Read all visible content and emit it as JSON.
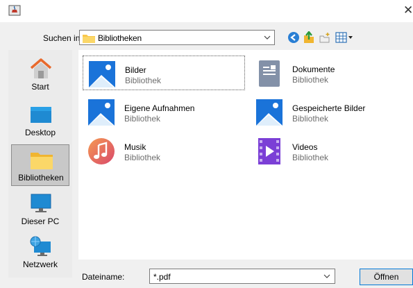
{
  "titlebar": {
    "app_icon": "java-cup-icon",
    "close_glyph": "✕"
  },
  "lookin": {
    "label": "Suchen in:",
    "value": "Bibliotheken"
  },
  "toolbar": [
    "back-arrow-icon",
    "up-folder-icon",
    "new-folder-icon",
    "view-menu-icon"
  ],
  "sidebar": {
    "items": [
      {
        "label": "Start",
        "icon": "home-icon",
        "selected": false
      },
      {
        "label": "Desktop",
        "icon": "desktop-icon",
        "selected": false
      },
      {
        "label": "Bibliotheken",
        "icon": "libraries-folder-icon",
        "selected": true
      },
      {
        "label": "Dieser PC",
        "icon": "computer-icon",
        "selected": false
      },
      {
        "label": "Netzwerk",
        "icon": "network-icon",
        "selected": false
      }
    ]
  },
  "files": [
    {
      "name": "Bilder",
      "type": "Bibliothek",
      "icon": "pictures-library-icon"
    },
    {
      "name": "Dokumente",
      "type": "Bibliothek",
      "icon": "documents-library-icon"
    },
    {
      "name": "Eigene Aufnahmen",
      "type": "Bibliothek",
      "icon": "camera-roll-library-icon"
    },
    {
      "name": "Gespeicherte Bilder",
      "type": "Bibliothek",
      "icon": "saved-pictures-library-icon"
    },
    {
      "name": "Musik",
      "type": "Bibliothek",
      "icon": "music-library-icon"
    },
    {
      "name": "Videos",
      "type": "Bibliothek",
      "icon": "videos-library-icon"
    }
  ],
  "filename": {
    "label": "Dateiname:",
    "value": "*.pdf"
  },
  "open_button": {
    "label": "Öffnen"
  },
  "colors": {
    "accent": "#0078d7",
    "folder_yellow": "#f8c74b",
    "pictures_blue": "#1a73d9",
    "music_orange": "#f06a3d",
    "video_purple": "#7b3fd6"
  }
}
